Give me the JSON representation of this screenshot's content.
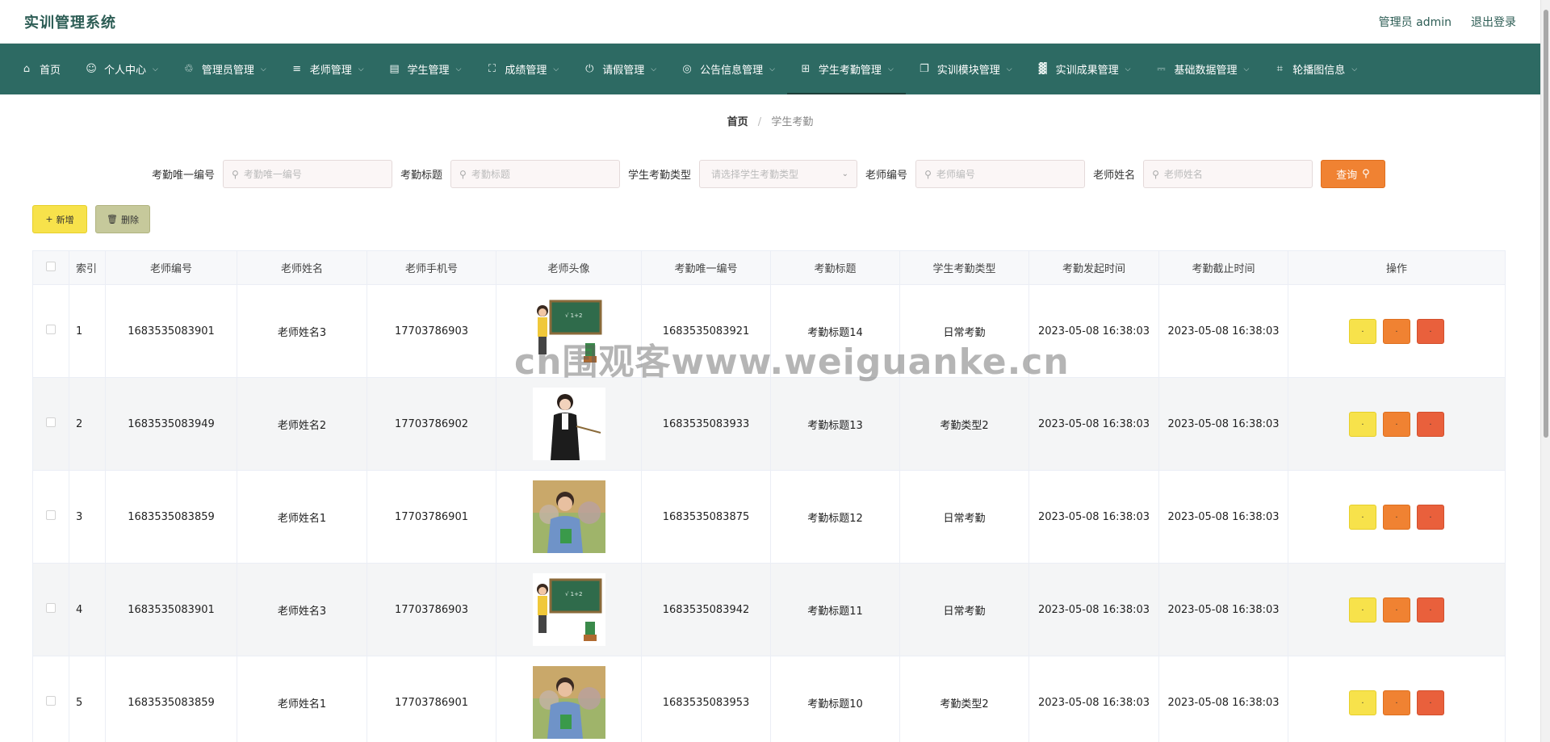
{
  "header": {
    "app_title": "实训管理系统",
    "user_label": "管理员 admin",
    "logout_label": "退出登录"
  },
  "nav": {
    "items": [
      {
        "label": "首页",
        "icon": "home-icon",
        "caret": false
      },
      {
        "label": "个人中心",
        "icon": "user-icon",
        "caret": true
      },
      {
        "label": "管理员管理",
        "icon": "bell-off-icon",
        "caret": true
      },
      {
        "label": "老师管理",
        "icon": "sliders-icon",
        "caret": true
      },
      {
        "label": "学生管理",
        "icon": "suitcase-icon",
        "caret": true
      },
      {
        "label": "成绩管理",
        "icon": "fullscreen-icon",
        "caret": true
      },
      {
        "label": "请假管理",
        "icon": "power-icon",
        "caret": true
      },
      {
        "label": "公告信息管理",
        "icon": "globe-icon",
        "caret": true
      },
      {
        "label": "学生考勤管理",
        "icon": "grid-icon",
        "caret": true,
        "active": true
      },
      {
        "label": "实训模块管理",
        "icon": "copy-icon",
        "caret": true
      },
      {
        "label": "实训成果管理",
        "icon": "chart-icon",
        "caret": true
      },
      {
        "label": "基础数据管理",
        "icon": "usb-icon",
        "caret": true
      },
      {
        "label": "轮播图信息",
        "icon": "crop-icon",
        "caret": true
      }
    ]
  },
  "breadcrumb": {
    "home": "首页",
    "separator": "/",
    "current": "学生考勤"
  },
  "search": {
    "fields": [
      {
        "label": "考勤唯一编号",
        "placeholder": "考勤唯一编号"
      },
      {
        "label": "考勤标题",
        "placeholder": "考勤标题"
      },
      {
        "label": "学生考勤类型",
        "placeholder": "请选择学生考勤类型"
      },
      {
        "label": "老师编号",
        "placeholder": "老师编号"
      },
      {
        "label": "老师姓名",
        "placeholder": "老师姓名"
      }
    ],
    "query_label": "查询"
  },
  "toolbar": {
    "add_label": "新增",
    "delete_label": "删除"
  },
  "table": {
    "headers": [
      "索引",
      "老师编号",
      "老师姓名",
      "老师手机号",
      "老师头像",
      "考勤唯一编号",
      "考勤标题",
      "学生考勤类型",
      "考勤发起时间",
      "考勤截止时间",
      "操作"
    ],
    "rows": [
      {
        "index": "1",
        "teacher_no": "1683535083901",
        "teacher_name": "老师姓名3",
        "phone": "17703786903",
        "avatar": "teacher-blackboard",
        "att_no": "1683535083921",
        "title": "考勤标题14",
        "type": "日常考勤",
        "start": "2023-05-08 16:38:03",
        "end": "2023-05-08 16:38:03"
      },
      {
        "index": "2",
        "teacher_no": "1683535083949",
        "teacher_name": "老师姓名2",
        "phone": "17703786902",
        "avatar": "teacher-pointer",
        "att_no": "1683535083933",
        "title": "考勤标题13",
        "type": "考勤类型2",
        "start": "2023-05-08 16:38:03",
        "end": "2023-05-08 16:38:03"
      },
      {
        "index": "3",
        "teacher_no": "1683535083859",
        "teacher_name": "老师姓名1",
        "phone": "17703786901",
        "avatar": "teacher-photo",
        "att_no": "1683535083875",
        "title": "考勤标题12",
        "type": "日常考勤",
        "start": "2023-05-08 16:38:03",
        "end": "2023-05-08 16:38:03"
      },
      {
        "index": "4",
        "teacher_no": "1683535083901",
        "teacher_name": "老师姓名3",
        "phone": "17703786903",
        "avatar": "teacher-blackboard",
        "att_no": "1683535083942",
        "title": "考勤标题11",
        "type": "日常考勤",
        "start": "2023-05-08 16:38:03",
        "end": "2023-05-08 16:38:03"
      },
      {
        "index": "5",
        "teacher_no": "1683535083859",
        "teacher_name": "老师姓名1",
        "phone": "17703786901",
        "avatar": "teacher-photo",
        "att_no": "1683535083953",
        "title": "考勤标题10",
        "type": "考勤类型2",
        "start": "2023-05-08 16:38:03",
        "end": "2023-05-08 16:38:03"
      }
    ]
  },
  "watermark": "cn围观客www.weiguanke.cn",
  "colors": {
    "nav_bg": "#2d6a63",
    "query_button": "#f08232",
    "add_button": "#f7e24b",
    "delete_button": "#c6c99b",
    "op_yellow": "#f7e24b",
    "op_orange": "#f08232",
    "op_red": "#e9603c"
  }
}
